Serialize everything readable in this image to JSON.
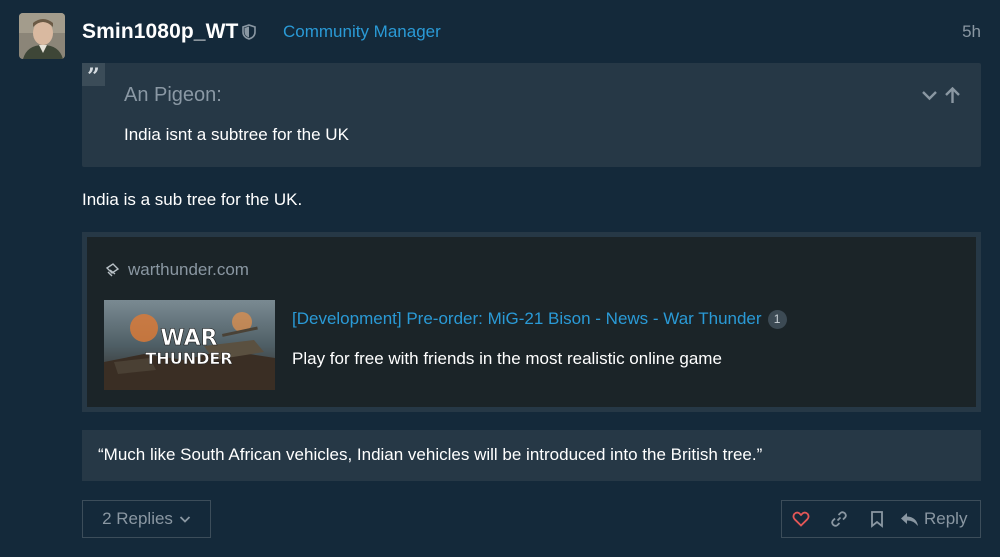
{
  "post": {
    "username": "Smin1080p_WT",
    "user_title": "Community Manager",
    "date": "5h",
    "quote": {
      "author": "An Pigeon:",
      "text": "India isnt a subtree for the UK"
    },
    "body": "India is a sub tree for the UK.",
    "onebox": {
      "source": "warthunder.com",
      "title": "[Development] Pre-order: MiG-21 Bison - News - War Thunder",
      "click_count": "1",
      "description": "Play for free with friends in the most realistic online game",
      "thumb_logo_line1": "WAR",
      "thumb_logo_line2": "THUNDER"
    },
    "blockquote": "“Much like South African vehicles, Indian vehicles will be introduced into the British tree.”"
  },
  "controls": {
    "replies_label": "2 Replies",
    "reply_label": "Reply"
  },
  "icons": {
    "like": "heart-icon",
    "link": "link-icon",
    "bookmark": "bookmark-icon",
    "reply": "reply-icon",
    "moderator": "shield-icon",
    "quote_expand": "chevron-down-icon",
    "quote_jump": "arrow-up-icon",
    "onebox_source": "favicon-icon"
  },
  "colors": {
    "background": "#14293a",
    "link": "#2a9ad6",
    "muted": "#8a97a2",
    "quote_bg": "#263846",
    "like": "#e45757"
  }
}
